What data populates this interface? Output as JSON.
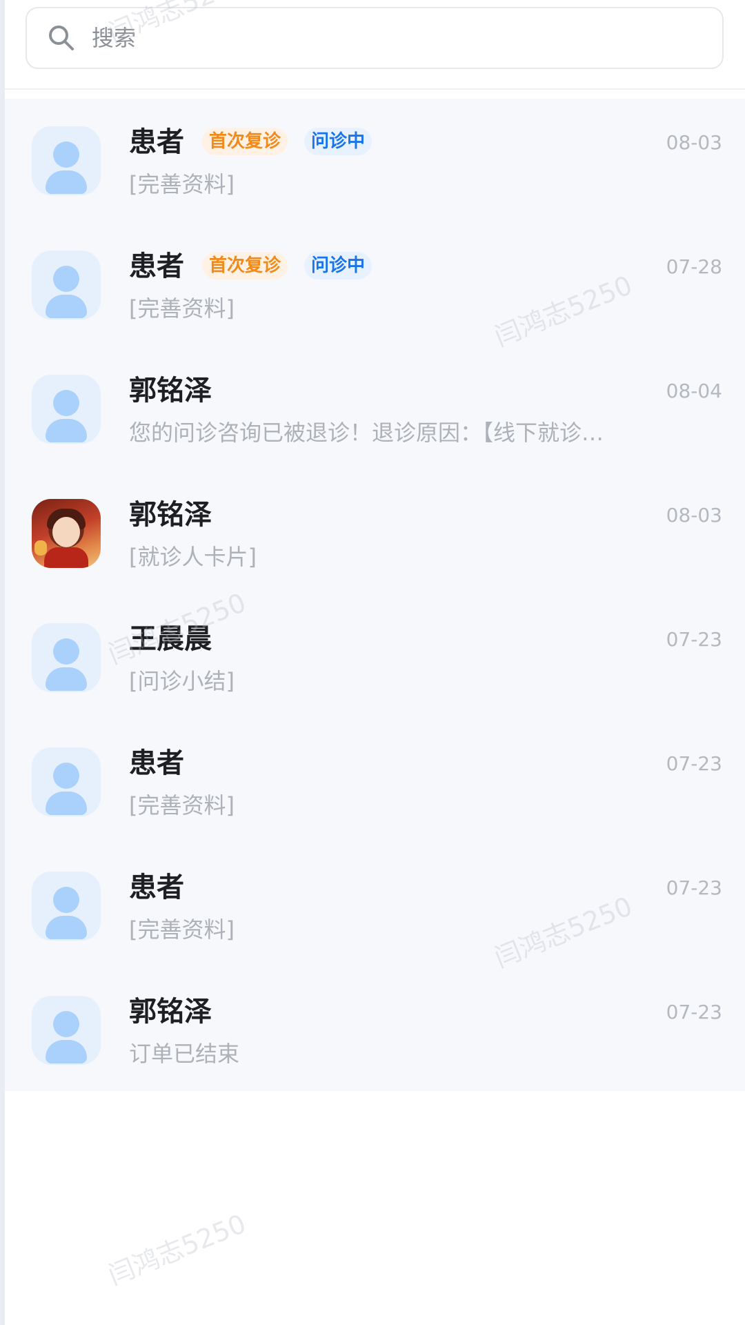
{
  "search": {
    "placeholder": "搜索"
  },
  "conversations": [
    {
      "name": "患者",
      "tags": [
        "首次复诊",
        "问诊中"
      ],
      "date": "08-03",
      "message": "[完善资料]",
      "avatar": "default-avatar"
    },
    {
      "name": "患者",
      "tags": [
        "首次复诊",
        "问诊中"
      ],
      "date": "07-28",
      "message": "[完善资料]",
      "avatar": "default-avatar"
    },
    {
      "name": "郭铭泽",
      "tags": [],
      "date": "08-04",
      "message": "您的问诊咨询已被退诊！退诊原因：【线下就诊…",
      "avatar": "default-avatar"
    },
    {
      "name": "郭铭泽",
      "tags": [],
      "date": "08-03",
      "message": "[就诊人卡片]",
      "avatar": "photo-avatar"
    },
    {
      "name": "王晨晨",
      "tags": [],
      "date": "07-23",
      "message": "[问诊小结]",
      "avatar": "default-avatar"
    },
    {
      "name": "患者",
      "tags": [],
      "date": "07-23",
      "message": "[完善资料]",
      "avatar": "default-avatar"
    },
    {
      "name": "患者",
      "tags": [],
      "date": "07-23",
      "message": "[完善资料]",
      "avatar": "default-avatar"
    },
    {
      "name": "郭铭泽",
      "tags": [],
      "date": "07-23",
      "message": "订单已结束",
      "avatar": "default-avatar"
    }
  ],
  "watermark": "闫鸿志5250",
  "colors": {
    "tag_orange": "#f08a1c",
    "tag_blue": "#1a73e8",
    "list_background": "#f6f8fc",
    "avatar_icon": "#a9d1fb"
  }
}
